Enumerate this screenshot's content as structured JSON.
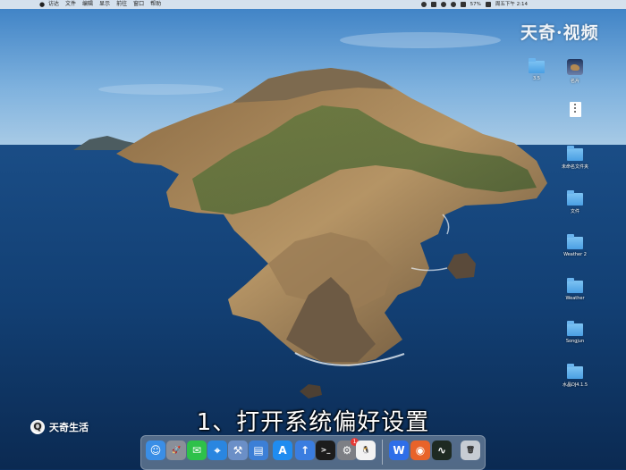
{
  "menubar": {
    "apple": "",
    "items": [
      "访达",
      "文件",
      "编辑",
      "显示",
      "前往",
      "窗口",
      "帮助"
    ],
    "battery": "57%",
    "clock": "周五下午 2:14"
  },
  "desktop": {
    "icons": [
      {
        "label": "3.5",
        "kind": "folder"
      },
      {
        "label": "名片",
        "kind": "image"
      },
      {
        "label": "",
        "kind": "archive"
      },
      {
        "label": "未命名文件夹",
        "kind": "folder"
      },
      {
        "label": "文件",
        "kind": "folder"
      },
      {
        "label": "Weather 2",
        "kind": "folder"
      },
      {
        "label": "Weather",
        "kind": "folder"
      },
      {
        "label": "Songjun",
        "kind": "folder"
      },
      {
        "label": "水晶DJ4.1.5",
        "kind": "folder"
      }
    ]
  },
  "watermark": {
    "top": "天奇·视频",
    "bottom": "天奇生活",
    "bottom_icon": "Q"
  },
  "subtitle": "1、打开系统偏好设置",
  "dock": {
    "apps": [
      {
        "icon": "finder-icon",
        "glyph": "☺",
        "color": "#3a8ee6"
      },
      {
        "icon": "launchpad-icon",
        "glyph": "🚀",
        "color": "#8a8f99"
      },
      {
        "icon": "wechat-icon",
        "glyph": "✉",
        "color": "#2ec14a"
      },
      {
        "icon": "safari-icon",
        "glyph": "⌖",
        "color": "#2a86e0"
      },
      {
        "icon": "xcode-tools-icon",
        "glyph": "⚒",
        "color": "#6b8fc7"
      },
      {
        "icon": "files-icon",
        "glyph": "▤",
        "color": "#3c7fd6"
      },
      {
        "icon": "appstore-icon",
        "glyph": "A",
        "color": "#1f8cf0"
      },
      {
        "icon": "upload-icon",
        "glyph": "↑",
        "color": "#3a7de0"
      },
      {
        "icon": "terminal-icon",
        "glyph": ">_",
        "color": "#1c1c1c"
      },
      {
        "icon": "system-preferences-icon",
        "glyph": "⚙",
        "color": "#7d7f85"
      },
      {
        "icon": "qq-icon",
        "glyph": "🐧",
        "color": "#f2f2f2"
      },
      {
        "icon": "wps-icon",
        "glyph": "W",
        "color": "#2e6ee8"
      },
      {
        "icon": "firefox-icon",
        "glyph": "◉",
        "color": "#e8632a"
      },
      {
        "icon": "activity-monitor-icon",
        "glyph": "∿",
        "color": "#1e2a22"
      },
      {
        "icon": "trash-icon",
        "glyph": "🗑",
        "color": "#c7ccd3"
      }
    ],
    "badge": "1"
  }
}
